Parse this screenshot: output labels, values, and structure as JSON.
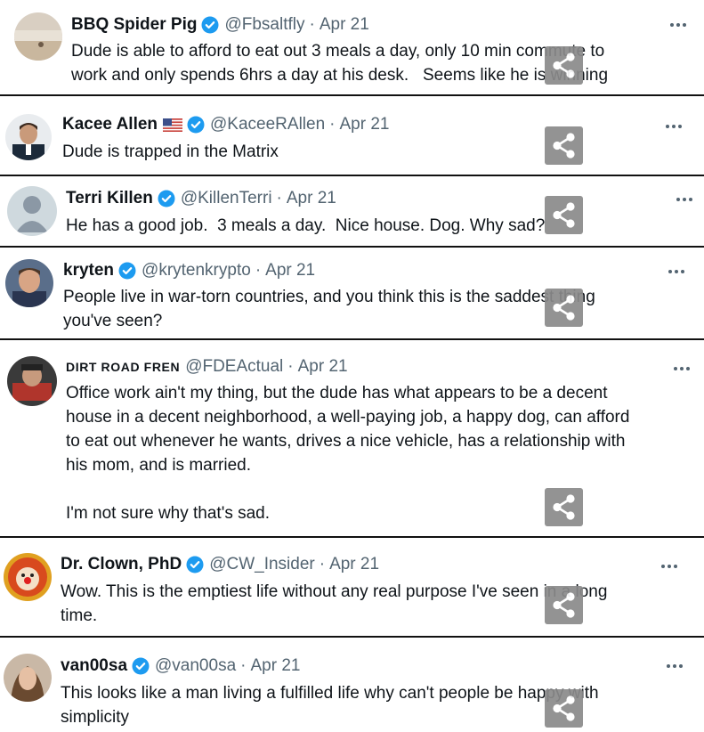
{
  "colors": {
    "verified": "#1d9bf0",
    "text": "#0f1419",
    "muted": "#536471",
    "share_bg": "#8a8a8a"
  },
  "icons": {
    "verified": "verified-badge-icon",
    "more": "more-options-icon",
    "share": "share-icon"
  },
  "tweets": [
    {
      "name": "BBQ Spider Pig",
      "handle": "@Fbsaltfly",
      "date": "Apr 21",
      "text": "Dude is able to afford to eat out 3 meals a day, only 10 min commute to\nwork and only spends 6hrs a day at his desk.   Seems like he is winning"
    },
    {
      "name": "Kacee Allen",
      "handle": "@KaceeRAllen",
      "date": "Apr 21",
      "text": "Dude is trapped in the Matrix"
    },
    {
      "name": "Terri Killen",
      "handle": "@KillenTerri",
      "date": "Apr 21",
      "text": "He has a good job.  3 meals a day.  Nice house. Dog. Why sad?"
    },
    {
      "name": "kryten",
      "handle": "@krytenkrypto",
      "date": "Apr 21",
      "text": "People live in war-torn countries, and you think this is the saddest thing\nyou've seen?"
    },
    {
      "name": "DIRT ROAD FREN",
      "handle": "@FDEActual",
      "date": "Apr 21",
      "text": "Office work ain't my thing, but the dude has what appears to be a decent\nhouse in a decent neighborhood, a well-paying job, a happy dog, can afford\nto eat out whenever he wants, drives a nice vehicle, has a relationship with\nhis mom, and is married.\n\nI'm not sure why that's sad."
    },
    {
      "name": "Dr. Clown, PhD",
      "handle": "@CW_Insider",
      "date": "Apr 21",
      "text": "Wow. This is the emptiest life without any real purpose I've seen in a long\ntime."
    },
    {
      "name": "van00sa",
      "handle": "@van00sa",
      "date": "Apr 21",
      "text": "This looks like a man living a fulfilled life why can't people be happy with\nsimplicity"
    }
  ]
}
